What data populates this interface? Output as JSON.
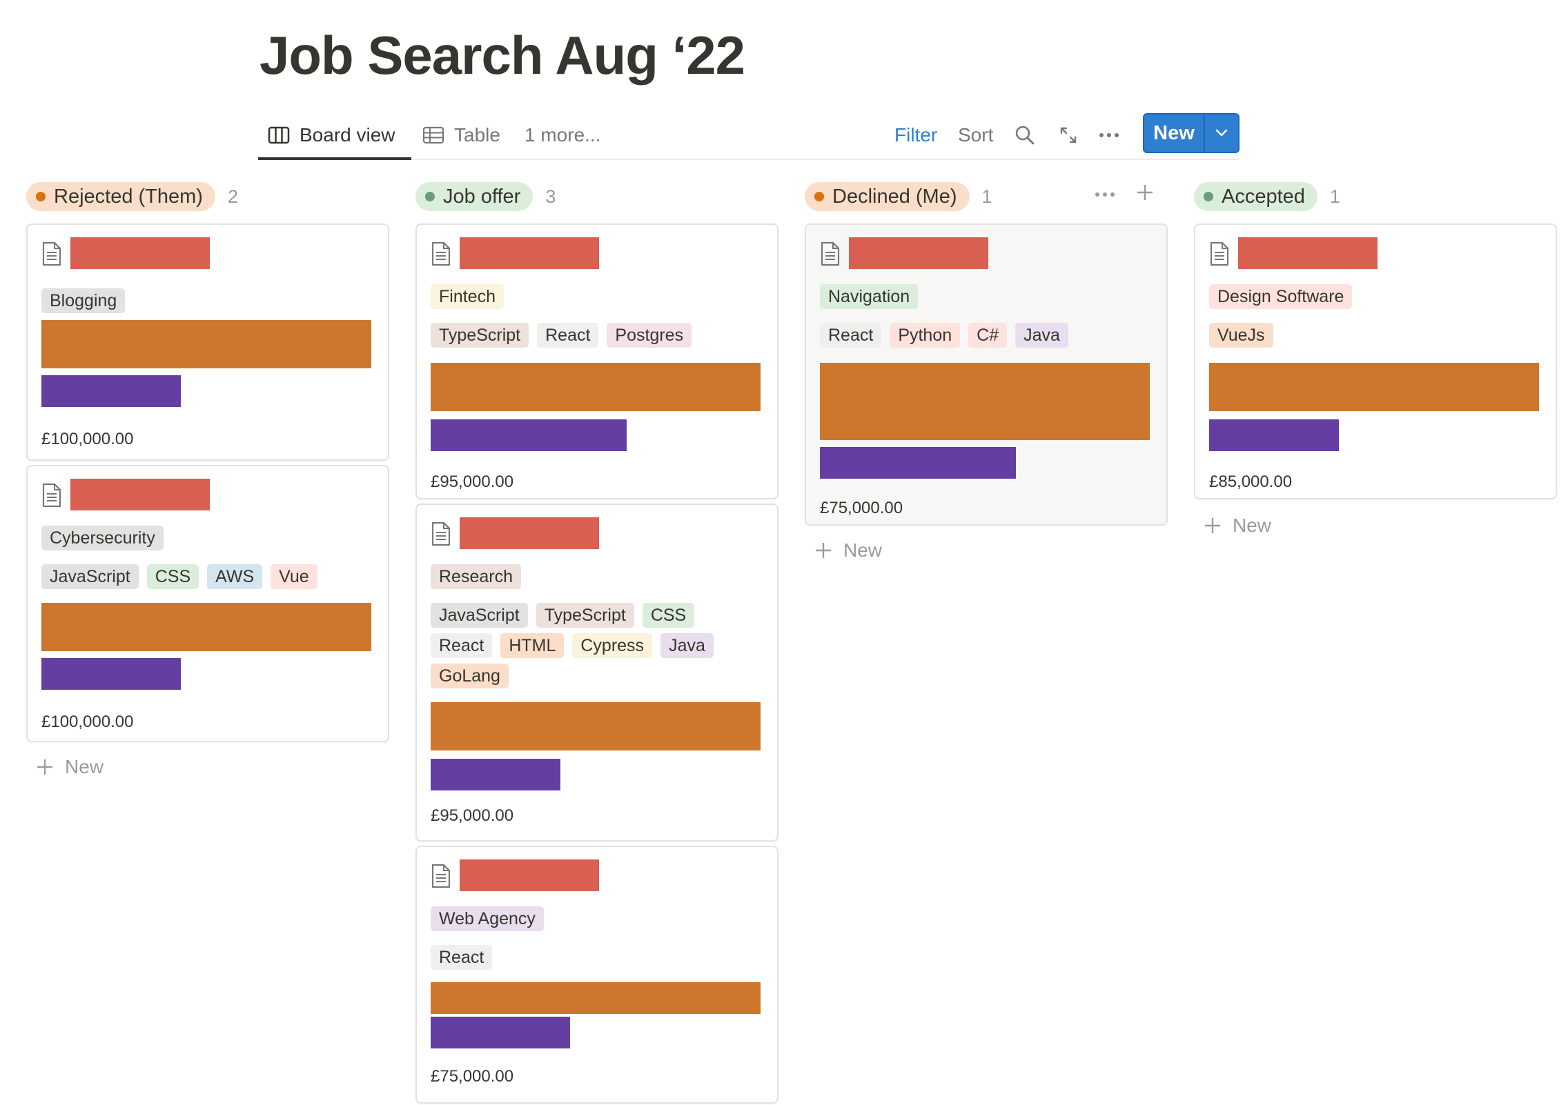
{
  "page": {
    "title": "Job Search Aug ‘22"
  },
  "viewbar": {
    "board_label": "Board view",
    "table_label": "Table",
    "more_label": "1 more...",
    "filter_label": "Filter",
    "sort_label": "Sort",
    "new_label": "New",
    "accent_color": "#2f7fd0"
  },
  "icons": {
    "board": "board-view-icon",
    "table": "table-icon",
    "search": "search-icon",
    "expand": "expand-icon",
    "more": "more-dots-icon",
    "chevron": "chevron-down-icon",
    "doc": "document-icon",
    "plus": "plus-icon"
  },
  "columns": [
    {
      "label": "Rejected (Them)",
      "count": "2",
      "dot_color": "#d9730d",
      "pill_color": "#fadec9",
      "cards": [
        {
          "tags_row1": [
            {
              "label": "Blogging",
              "color": "gray"
            }
          ],
          "tags_row2": [],
          "salary": "£100,000.00"
        },
        {
          "tags_row1": [
            {
              "label": "Cybersecurity",
              "color": "gray"
            }
          ],
          "tags_row2": [
            {
              "label": "JavaScript",
              "color": "gray"
            },
            {
              "label": "CSS",
              "color": "green"
            },
            {
              "label": "AWS",
              "color": "blue"
            },
            {
              "label": "Vue",
              "color": "red"
            }
          ],
          "salary": "£100,000.00"
        }
      ],
      "new_label": "New"
    },
    {
      "label": "Job offer",
      "count": "3",
      "dot_color": "#6c9b7d",
      "pill_color": "#dbeddb",
      "cards": [
        {
          "tags_row1": [
            {
              "label": "Fintech",
              "color": "yellow"
            }
          ],
          "tags_row2": [
            {
              "label": "TypeScript",
              "color": "brown"
            },
            {
              "label": "React",
              "color": "lightgray"
            },
            {
              "label": "Postgres",
              "color": "pink"
            }
          ],
          "salary": "£95,000.00"
        },
        {
          "tags_row1": [
            {
              "label": "Research",
              "color": "brown"
            }
          ],
          "tags_row2": [
            {
              "label": "JavaScript",
              "color": "gray"
            },
            {
              "label": "TypeScript",
              "color": "brown"
            },
            {
              "label": "CSS",
              "color": "green"
            }
          ],
          "tags_row3": [
            {
              "label": "React",
              "color": "lightgray"
            },
            {
              "label": "HTML",
              "color": "orange"
            },
            {
              "label": "Cypress",
              "color": "yellow"
            },
            {
              "label": "Java",
              "color": "purple"
            }
          ],
          "tags_row4": [
            {
              "label": "GoLang",
              "color": "orange"
            }
          ],
          "salary": "£95,000.00"
        },
        {
          "tags_row1": [
            {
              "label": "Web Agency",
              "color": "purple"
            }
          ],
          "tags_row2": [
            {
              "label": "React",
              "color": "lightgray"
            }
          ],
          "salary": "£75,000.00"
        }
      ],
      "new_label": "New"
    },
    {
      "label": "Declined (Me)",
      "count": "1",
      "dot_color": "#d9730d",
      "pill_color": "#fadec9",
      "cards": [
        {
          "tags_row1": [
            {
              "label": "Navigation",
              "color": "green"
            }
          ],
          "tags_row2": [
            {
              "label": "React",
              "color": "lightgray"
            },
            {
              "label": "Python",
              "color": "red"
            },
            {
              "label": "C#",
              "color": "red"
            },
            {
              "label": "Java",
              "color": "purple"
            }
          ],
          "salary": "£75,000.00"
        }
      ],
      "new_label": "New"
    },
    {
      "label": "Accepted",
      "count": "1",
      "dot_color": "#6c9b7d",
      "pill_color": "#dbeddb",
      "cards": [
        {
          "tags_row1": [
            {
              "label": "Design Software",
              "color": "red"
            }
          ],
          "tags_row2": [
            {
              "label": "VueJs",
              "color": "orange"
            }
          ],
          "salary": "£85,000.00"
        }
      ],
      "new_label": "New"
    }
  ]
}
